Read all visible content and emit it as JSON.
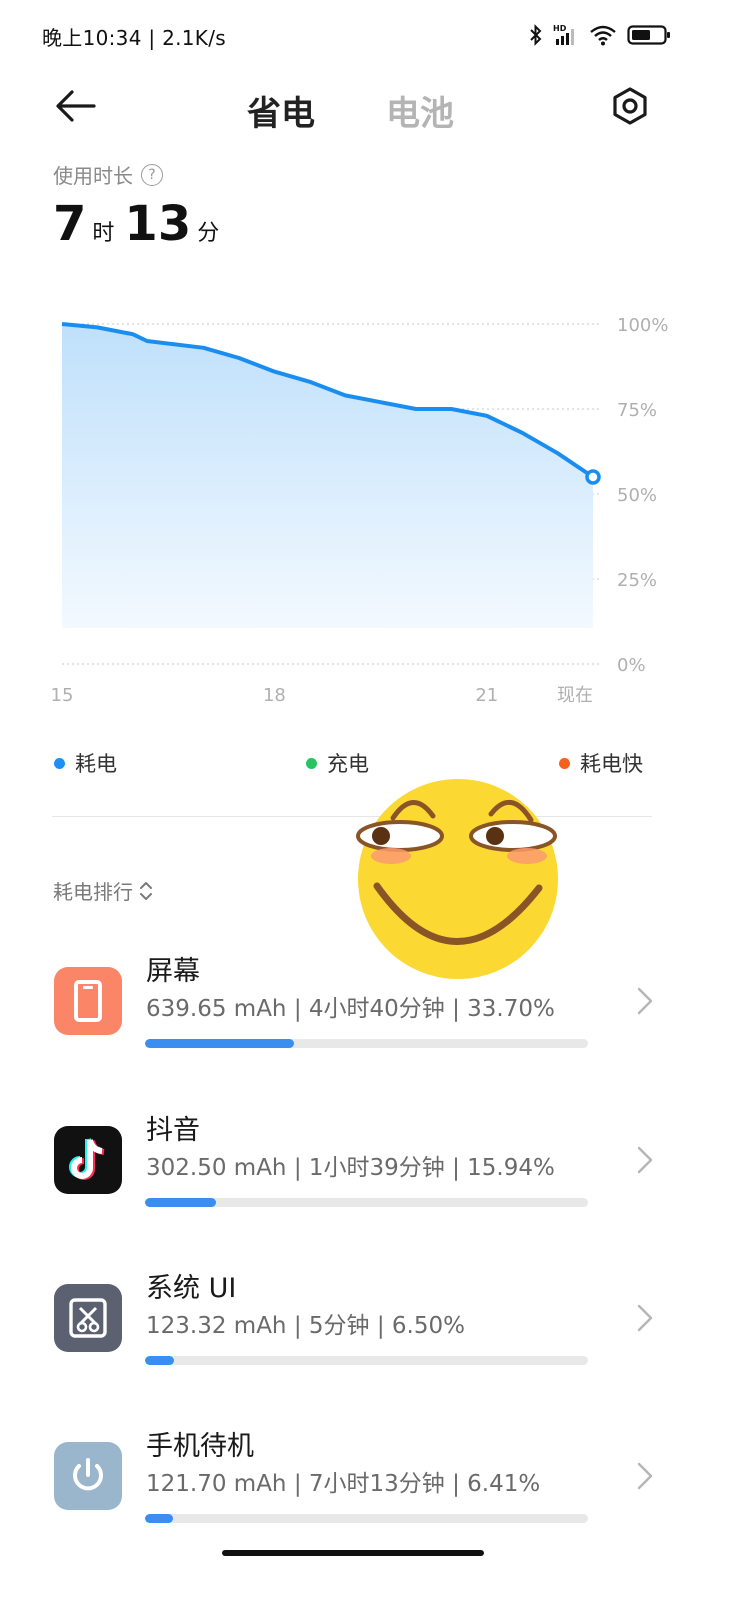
{
  "status_bar": {
    "time_speed": "晚上10:34 | 2.1K/s",
    "icons": [
      "bluetooth-icon",
      "hd-signal-icon",
      "wifi-icon",
      "battery-icon"
    ]
  },
  "header": {
    "back_icon": "arrow-left-icon",
    "tab_saving": "省电",
    "tab_battery": "电池",
    "settings_icon": "hexagon-settings-icon"
  },
  "usage": {
    "label": "使用时长",
    "hours": "7",
    "hours_unit": "时",
    "minutes": "13",
    "minutes_unit": "分"
  },
  "chart_data": {
    "type": "area",
    "title": "",
    "x_ticks": [
      "15",
      "18",
      "21",
      "现在"
    ],
    "y_ticks": [
      "100%",
      "75%",
      "50%",
      "25%",
      "0%"
    ],
    "ylim": [
      0,
      100
    ],
    "series": [
      {
        "x": [
          15.0,
          15.5,
          16.0,
          16.2,
          17.0,
          17.5,
          18.0,
          18.5,
          19.0,
          19.5,
          20.0,
          20.5,
          21.0,
          21.5,
          22.0,
          22.5
        ],
        "values": [
          100,
          99,
          97,
          95,
          93,
          90,
          86,
          83,
          79,
          77,
          75,
          75,
          73,
          68,
          62,
          55
        ]
      }
    ],
    "colors": {
      "line": "#1a8ef0",
      "fill_top": "#bfe0fb",
      "fill_bottom": "#f3f9ff"
    },
    "grid": "dotted"
  },
  "legend": [
    {
      "label": "耗电",
      "color": "#1e90f5"
    },
    {
      "label": "充电",
      "color": "#26c462"
    },
    {
      "label": "耗电快",
      "color": "#f4611f"
    }
  ],
  "ranking": {
    "title": "耗电排行",
    "items": [
      {
        "name": "屏幕",
        "detail": "639.65 mAh | 4小时40分钟 | 33.70%",
        "share": 0.337,
        "icon": "screen-icon",
        "icon_bg": "#fb8567"
      },
      {
        "name": "抖音",
        "detail": "302.50 mAh | 1小时39分钟 | 15.94%",
        "share": 0.1594,
        "icon": "tiktok-icon",
        "icon_bg": "#111111"
      },
      {
        "name": "系统 UI",
        "detail": "123.32 mAh | 5分钟 | 6.50%",
        "share": 0.065,
        "icon": "system-ui-icon",
        "icon_bg": "#5b6171"
      },
      {
        "name": "手机待机",
        "detail": "121.70 mAh | 7小时13分钟 | 6.41%",
        "share": 0.0641,
        "icon": "power-icon",
        "icon_bg": "#9ab6cc"
      }
    ]
  }
}
